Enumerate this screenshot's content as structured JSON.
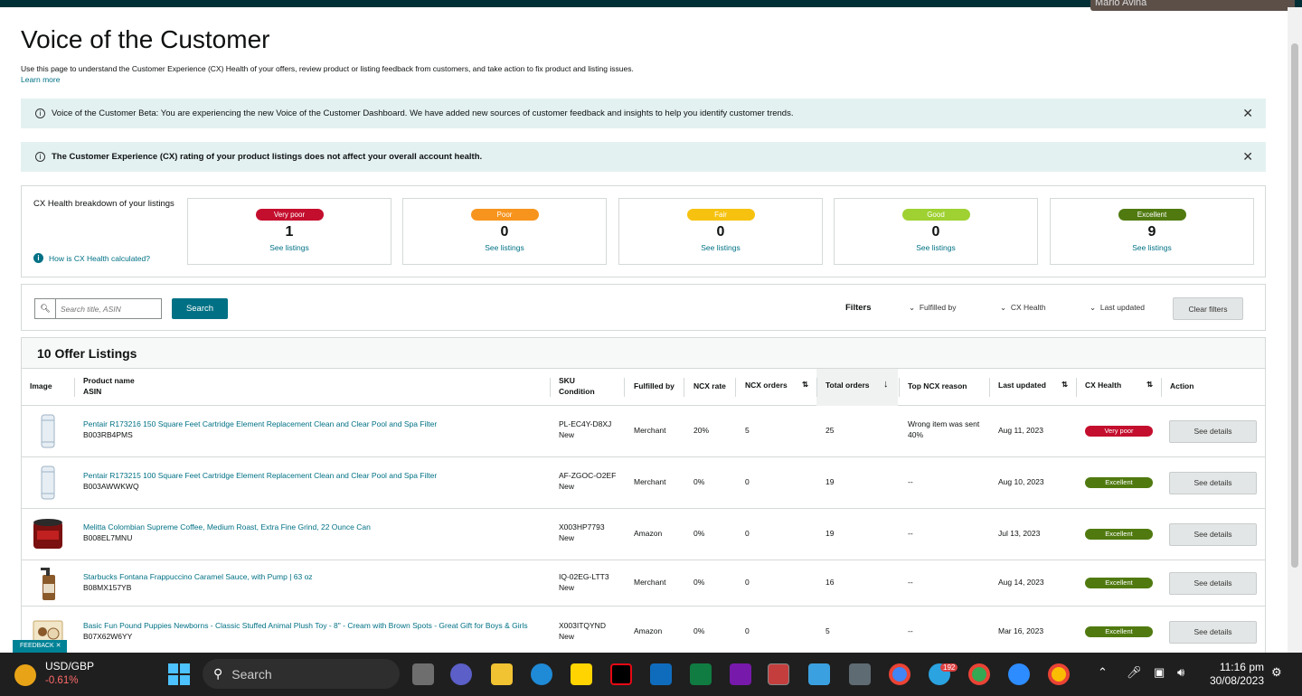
{
  "webcam_name": "Mario Avina",
  "page": {
    "title": "Voice of the Customer",
    "intro": "Use this page to understand the Customer Experience (CX) Health of your offers, review product or listing feedback from customers, and take action to fix product and listing issues.",
    "learn_more": "Learn more"
  },
  "banners": [
    {
      "text": "Voice of the Customer Beta: You are experiencing the new Voice of the Customer Dashboard. We have added new sources of customer feedback and insights to help you identify customer trends.",
      "close": "✕"
    },
    {
      "text": "The Customer Experience (CX) rating of your product listings does not affect your overall account health.",
      "close": "✕"
    }
  ],
  "breakdown": {
    "title": "CX Health breakdown of your listings",
    "how_link": "How is CX Health calculated?",
    "cards": [
      {
        "label": "Very poor",
        "count": "1",
        "link": "See listings",
        "color": "#c40e2e"
      },
      {
        "label": "Poor",
        "count": "0",
        "link": "See listings",
        "color": "#f7941d"
      },
      {
        "label": "Fair",
        "count": "0",
        "link": "See listings",
        "color": "#f6c20f"
      },
      {
        "label": "Good",
        "count": "0",
        "link": "See listings",
        "color": "#9ed131"
      },
      {
        "label": "Excellent",
        "count": "9",
        "link": "See listings",
        "color": "#507a10"
      }
    ]
  },
  "filters": {
    "search_placeholder": "Search title, ASIN",
    "search_button": "Search",
    "label": "Filters",
    "fulfilled_by": "Fulfilled by",
    "cx_health": "CX Health",
    "last_updated": "Last updated",
    "clear": "Clear filters"
  },
  "listings": {
    "header": "10 Offer Listings",
    "columns": {
      "image": "Image",
      "product_name": "Product name",
      "asin": "ASIN",
      "sku": "SKU",
      "condition": "Condition",
      "fulfilled_by": "Fulfilled by",
      "ncx_rate": "NCX rate",
      "ncx_orders": "NCX orders",
      "total_orders": "Total orders",
      "top_reason": "Top NCX reason",
      "last_updated": "Last updated",
      "cx_health": "CX Health",
      "action": "Action"
    },
    "rows": [
      {
        "name": "Pentair R173216 150 Square Feet Cartridge Element Replacement Clean and Clear Pool and Spa Filter",
        "asin": "B003RB4PMS",
        "sku": "PL-EC4Y-D8XJ",
        "condition": "New",
        "fulfilled": "Merchant",
        "rate": "20%",
        "ncx": "5",
        "total": "25",
        "reason": "Wrong item was sent",
        "reason2": "40%",
        "updated": "Aug 11, 2023",
        "health": "Very poor",
        "health_color": "#c40e2e",
        "action": "See details"
      },
      {
        "name": "Pentair R173215 100 Square Feet Cartridge Element Replacement Clean and Clear Pool and Spa Filter",
        "asin": "B003AWWKWQ",
        "sku": "AF-ZGOC-O2EF",
        "condition": "New",
        "fulfilled": "Merchant",
        "rate": "0%",
        "ncx": "0",
        "total": "19",
        "reason": "--",
        "reason2": "",
        "updated": "Aug 10, 2023",
        "health": "Excellent",
        "health_color": "#507a10",
        "action": "See details"
      },
      {
        "name": "Melitta Colombian Supreme Coffee, Medium Roast, Extra Fine Grind, 22 Ounce Can",
        "asin": "B008EL7MNU",
        "sku": "X003HP7793",
        "condition": "New",
        "fulfilled": "Amazon",
        "rate": "0%",
        "ncx": "0",
        "total": "19",
        "reason": "--",
        "reason2": "",
        "updated": "Jul 13, 2023",
        "health": "Excellent",
        "health_color": "#507a10",
        "action": "See details"
      },
      {
        "name": "Starbucks Fontana Frappuccino Caramel Sauce, with Pump | 63 oz",
        "asin": "B08MX157YB",
        "sku": "IQ-02EG-LTT3",
        "condition": "New",
        "fulfilled": "Merchant",
        "rate": "0%",
        "ncx": "0",
        "total": "16",
        "reason": "--",
        "reason2": "",
        "updated": "Aug 14, 2023",
        "health": "Excellent",
        "health_color": "#507a10",
        "action": "See details"
      },
      {
        "name": "Basic Fun Pound Puppies Newborns - Classic Stuffed Animal Plush Toy - 8\" - Cream with Brown Spots - Great Gift for Boys & Girls",
        "asin": "B07X62W6YY",
        "sku": "X003ITQYND",
        "condition": "New",
        "fulfilled": "Amazon",
        "rate": "0%",
        "ncx": "0",
        "total": "5",
        "reason": "--",
        "reason2": "",
        "updated": "Mar 16, 2023",
        "health": "Excellent",
        "health_color": "#507a10",
        "action": "See details"
      }
    ]
  },
  "feedback": "FEEDBACK ✕",
  "taskbar": {
    "currency": "USD/GBP",
    "change": "-0.61%",
    "search": "Search",
    "telegram_badge": "192",
    "time": "11:16 pm",
    "date": "30/08/2023"
  }
}
